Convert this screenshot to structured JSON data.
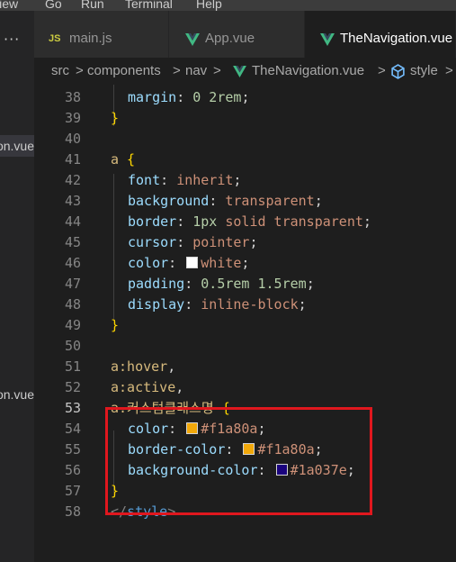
{
  "menubar": {
    "items": [
      "View",
      "Go",
      "Run",
      "Terminal",
      "Help"
    ]
  },
  "left_panel": {
    "more": "···",
    "files": [
      {
        "label": "TheNavigation.vue",
        "selected": true
      },
      {
        "label": "TheNavigation.vue",
        "selected": false
      }
    ]
  },
  "tabs": [
    {
      "label": "main.js",
      "icon": "js-icon"
    },
    {
      "label": "App.vue",
      "icon": "vue-icon"
    },
    {
      "label": "TheNavigation.vue",
      "icon": "vue-icon"
    }
  ],
  "breadcrumb": {
    "items": [
      "src",
      "components",
      "nav",
      "TheNavigation.vue",
      "style"
    ],
    "separator": ">"
  },
  "editor": {
    "current_line": "53",
    "lines": [
      {
        "n": "38",
        "tokens": [
          {
            "t": "margin",
            "c": "prop"
          },
          {
            "t": ": ",
            "c": "pun"
          },
          {
            "t": "0 2rem",
            "c": "num"
          },
          {
            "t": ";",
            "c": "pun"
          }
        ]
      },
      {
        "n": "39",
        "tokens": [
          {
            "t": "}",
            "c": "brace"
          }
        ]
      },
      {
        "n": "40",
        "tokens": []
      },
      {
        "n": "41",
        "tokens": [
          {
            "t": "a",
            "c": "sel"
          },
          {
            "t": " {",
            "c": "brace"
          }
        ]
      },
      {
        "n": "42",
        "tokens": [
          {
            "t": "font",
            "c": "prop"
          },
          {
            "t": ": ",
            "c": "pun"
          },
          {
            "t": "inherit",
            "c": "val"
          },
          {
            "t": ";",
            "c": "pun"
          }
        ]
      },
      {
        "n": "43",
        "tokens": [
          {
            "t": "background",
            "c": "prop"
          },
          {
            "t": ": ",
            "c": "pun"
          },
          {
            "t": "transparent",
            "c": "val"
          },
          {
            "t": ";",
            "c": "pun"
          }
        ]
      },
      {
        "n": "44",
        "tokens": [
          {
            "t": "border",
            "c": "prop"
          },
          {
            "t": ": ",
            "c": "pun"
          },
          {
            "t": "1px",
            "c": "num"
          },
          {
            "t": " solid transparent",
            "c": "val"
          },
          {
            "t": ";",
            "c": "pun"
          }
        ]
      },
      {
        "n": "45",
        "tokens": [
          {
            "t": "cursor",
            "c": "prop"
          },
          {
            "t": ": ",
            "c": "pun"
          },
          {
            "t": "pointer",
            "c": "val"
          },
          {
            "t": ";",
            "c": "pun"
          }
        ]
      },
      {
        "n": "46",
        "tokens": [
          {
            "t": "color",
            "c": "prop"
          },
          {
            "t": ": ",
            "c": "pun"
          },
          {
            "swatch": "#ffffff"
          },
          {
            "t": "white",
            "c": "val"
          },
          {
            "t": ";",
            "c": "pun"
          }
        ]
      },
      {
        "n": "47",
        "tokens": [
          {
            "t": "padding",
            "c": "prop"
          },
          {
            "t": ": ",
            "c": "pun"
          },
          {
            "t": "0.5rem 1.5rem",
            "c": "num"
          },
          {
            "t": ";",
            "c": "pun"
          }
        ]
      },
      {
        "n": "48",
        "tokens": [
          {
            "t": "display",
            "c": "prop"
          },
          {
            "t": ": ",
            "c": "pun"
          },
          {
            "t": "inline-block",
            "c": "val"
          },
          {
            "t": ";",
            "c": "pun"
          }
        ]
      },
      {
        "n": "49",
        "tokens": [
          {
            "t": "}",
            "c": "brace"
          }
        ]
      },
      {
        "n": "50",
        "tokens": []
      },
      {
        "n": "51",
        "tokens": [
          {
            "t": "a:hover",
            "c": "sel"
          },
          {
            "t": ",",
            "c": "pun"
          }
        ]
      },
      {
        "n": "52",
        "tokens": [
          {
            "t": "a:active",
            "c": "sel"
          },
          {
            "t": ",",
            "c": "pun"
          }
        ]
      },
      {
        "n": "53",
        "tokens": [
          {
            "t": "a.커스텀클래스명",
            "c": "sel"
          },
          {
            "t": " {",
            "c": "brace"
          }
        ]
      },
      {
        "n": "54",
        "tokens": [
          {
            "t": "color",
            "c": "prop"
          },
          {
            "t": ": ",
            "c": "pun"
          },
          {
            "swatch": "#f1a80a"
          },
          {
            "t": "#f1a80a",
            "c": "val"
          },
          {
            "t": ";",
            "c": "pun"
          }
        ]
      },
      {
        "n": "55",
        "tokens": [
          {
            "t": "border-color",
            "c": "prop"
          },
          {
            "t": ": ",
            "c": "pun"
          },
          {
            "swatch": "#f1a80a"
          },
          {
            "t": "#f1a80a",
            "c": "val"
          },
          {
            "t": ";",
            "c": "pun"
          }
        ]
      },
      {
        "n": "56",
        "tokens": [
          {
            "t": "background-color",
            "c": "prop"
          },
          {
            "t": ": ",
            "c": "pun"
          },
          {
            "swatch": "#1a037e"
          },
          {
            "t": "#1a037e",
            "c": "val"
          },
          {
            "t": ";",
            "c": "pun"
          }
        ]
      },
      {
        "n": "57",
        "tokens": [
          {
            "t": "}",
            "c": "brace"
          }
        ]
      },
      {
        "n": "58",
        "tokens": [
          {
            "t": "</",
            "c": "tagb"
          },
          {
            "t": "style",
            "c": "tag"
          },
          {
            "t": ">",
            "c": "tagb"
          }
        ]
      }
    ]
  },
  "colors": {
    "background": "#1e1e1e",
    "highlight_box": "#e0171e",
    "vue_icon": "#41b883"
  }
}
